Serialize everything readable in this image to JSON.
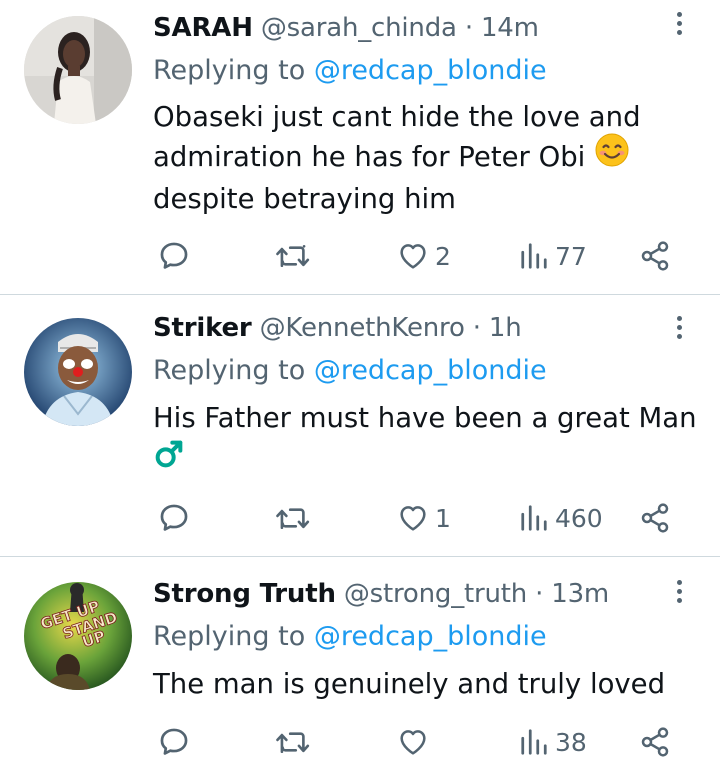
{
  "replies": [
    {
      "name": "SARAH",
      "handle": "@sarah_chinda",
      "time": "14m",
      "replying_prefix": "Replying to ",
      "replying_to": "@redcap_blondie",
      "text": "Obaseki just cant hide the love and\nadmiration he has for Peter Obi ",
      "text_after": "\ndespite betraying him",
      "emoji": "smiling-face-emoji",
      "likes": "2",
      "views": "77"
    },
    {
      "name": "Striker",
      "handle": "@KennethKenro",
      "time": "1h",
      "replying_prefix": "Replying to ",
      "replying_to": "@redcap_blondie",
      "text": "His Father must have been a great Man",
      "symbol": "♂",
      "likes": "1",
      "views": "460"
    },
    {
      "name": "Strong Truth",
      "handle": "@strong_truth",
      "time": "13m",
      "replying_prefix": "Replying to ",
      "replying_to": "@redcap_blondie",
      "text": "The man is genuinely and truly loved",
      "likes": "",
      "views": "38"
    }
  ],
  "separator": " · ",
  "avatar3_text": [
    "GET UP",
    "STAND",
    "UP"
  ],
  "colors": {
    "text": "#0f1419",
    "muted": "#536471",
    "link": "#1d9bf0",
    "divider": "#cfd9de",
    "male_symbol": "#00a693"
  },
  "icons": {
    "reply": "reply-icon",
    "retweet": "retweet-icon",
    "like": "heart-icon",
    "views": "views-icon",
    "share": "share-icon",
    "more": "more-vertical-icon"
  }
}
